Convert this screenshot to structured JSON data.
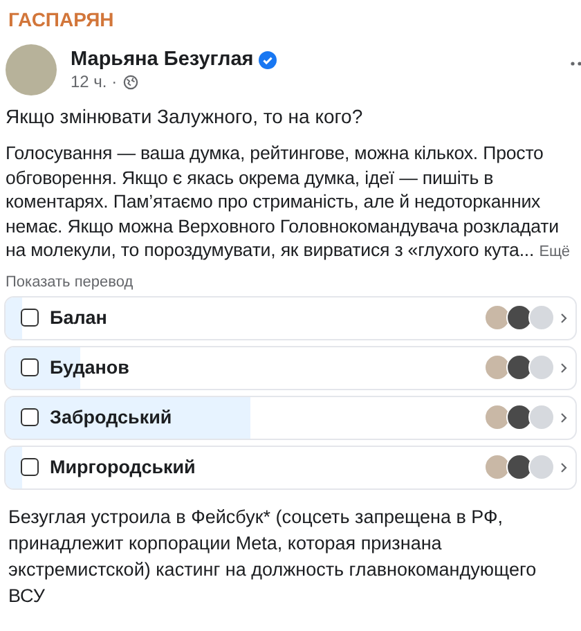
{
  "channel": {
    "title": "ГАСПАРЯН"
  },
  "post": {
    "author": "Марьяна Безуглая",
    "verified": true,
    "time": "12 ч. ·",
    "question": "Якщо змінювати Залужного, то на кого?",
    "text": "Голосування — ваша думка, рейтингове, можна кількох. Просто обговорення. Якщо є якась окрема думка, ідеї — пишіть в коментарях. Пам’ятаємо про стриманість, але й недоторканних немає. Якщо можна Верховного Головнокомандувача розкладати на молекули, то пороздумувати, як вирватися з «глухого кута...",
    "more": "Ещё",
    "translate": "Показать перевод"
  },
  "poll": [
    {
      "label": "Балан",
      "checked": false,
      "level": 0.03
    },
    {
      "label": "Буданов",
      "checked": false,
      "level": 0.13
    },
    {
      "label": "Забродський",
      "checked": false,
      "level": 0.43
    },
    {
      "label": "Миргородський",
      "checked": false,
      "level": 0.03
    }
  ],
  "caption": "Безуглая устроила в Фейсбук* (соцсеть запрещена в РФ, принадлежит корпорации Meta, которая признана экстремистской) кастинг на должность главнокомандующего ВСУ"
}
